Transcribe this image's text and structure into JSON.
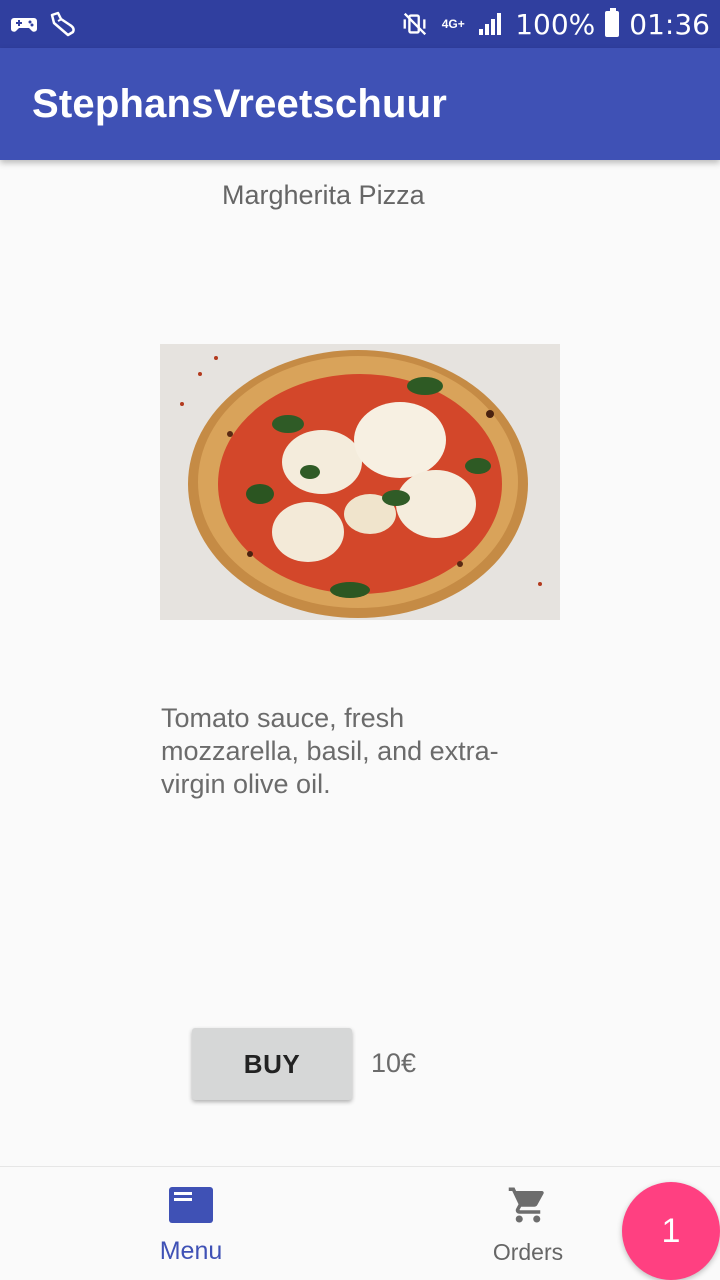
{
  "status_bar": {
    "left_icons": [
      "gamepad-icon",
      "shoe-icon"
    ],
    "network": "4G+",
    "battery": "100%",
    "time": "01:36"
  },
  "app": {
    "title": "StephansVreetschuur",
    "primary_color": "#3f51b5",
    "status_color": "#303f9f",
    "accent_color": "#ff4081"
  },
  "item": {
    "name": "Margherita Pizza",
    "image": "pizza-photo",
    "description": "Tomato sauce, fresh mozzarella, basil, and extra-virgin olive oil.",
    "buy_label": "BUY",
    "price": "10€"
  },
  "bottom_nav": {
    "items": [
      {
        "label": "Menu",
        "icon": "menu-book-icon",
        "active": true
      },
      {
        "label": "Orders",
        "icon": "cart-icon",
        "active": false
      }
    ]
  },
  "fab": {
    "label": "1"
  }
}
